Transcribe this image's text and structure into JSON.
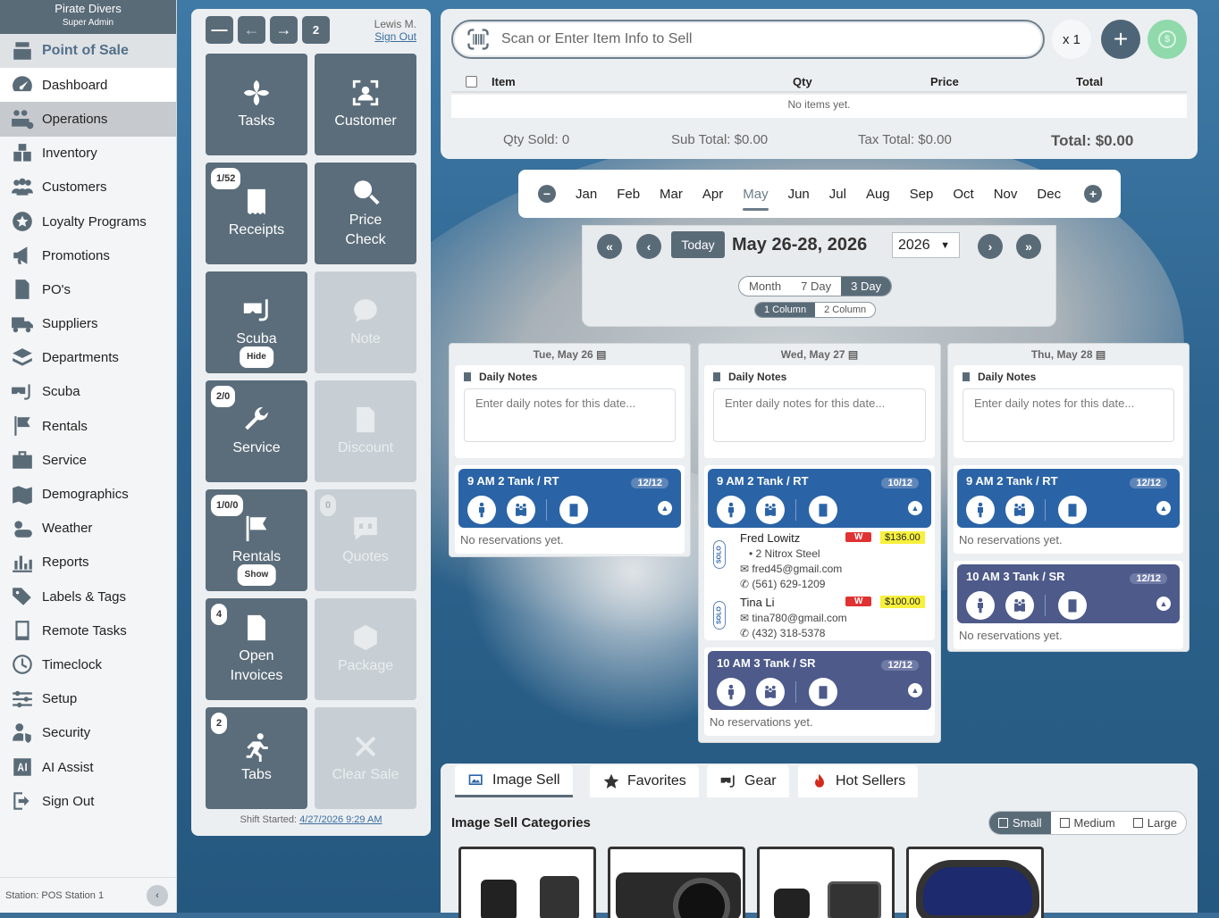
{
  "sidebar": {
    "company": "Pirate Divers",
    "role": "Super Admin",
    "items": [
      {
        "label": "Point of Sale",
        "icon": "register-icon"
      },
      {
        "label": "Dashboard",
        "icon": "speedometer-icon"
      },
      {
        "label": "Operations",
        "icon": "operations-icon"
      },
      {
        "label": "Inventory",
        "icon": "boxes-icon"
      },
      {
        "label": "Customers",
        "icon": "people-icon"
      },
      {
        "label": "Loyalty Programs",
        "icon": "loyalty-icon"
      },
      {
        "label": "Promotions",
        "icon": "megaphone-icon"
      },
      {
        "label": "PO's",
        "icon": "purchase-order-icon"
      },
      {
        "label": "Suppliers",
        "icon": "truck-icon"
      },
      {
        "label": "Departments",
        "icon": "layers-icon"
      },
      {
        "label": "Scuba",
        "icon": "mask-icon"
      },
      {
        "label": "Rentals",
        "icon": "flag-icon"
      },
      {
        "label": "Service",
        "icon": "toolbox-icon"
      },
      {
        "label": "Demographics",
        "icon": "map-icon"
      },
      {
        "label": "Weather",
        "icon": "weather-icon"
      },
      {
        "label": "Reports",
        "icon": "bar-chart-icon"
      },
      {
        "label": "Labels & Tags",
        "icon": "tags-icon"
      },
      {
        "label": "Remote Tasks",
        "icon": "tablet-icon"
      },
      {
        "label": "Timeclock",
        "icon": "clock-icon"
      },
      {
        "label": "Setup",
        "icon": "sliders-icon"
      },
      {
        "label": "Security",
        "icon": "user-shield-icon"
      },
      {
        "label": "AI Assist",
        "icon": "ai-icon"
      },
      {
        "label": "Sign Out",
        "icon": "sign-out-icon"
      }
    ],
    "station": "Station: POS Station 1"
  },
  "tiles_panel": {
    "nav_count": "2",
    "user_name": "Lewis M.",
    "sign_out": "Sign Out",
    "tiles": {
      "tasks": {
        "label": "Tasks"
      },
      "customer": {
        "label": "Customer"
      },
      "receipts": {
        "label": "Receipts",
        "badge": "1/52"
      },
      "price_check": {
        "label": "Price Check"
      },
      "scuba": {
        "label": "Scuba",
        "pill": "Hide"
      },
      "note": {
        "label": "Note"
      },
      "service": {
        "label": "Service",
        "badge": "2/0"
      },
      "discount": {
        "label": "Discount"
      },
      "rentals": {
        "label": "Rentals",
        "badge": "1/0/0",
        "pill": "Show"
      },
      "quotes": {
        "label": "Quotes",
        "badge": "0"
      },
      "open_invoices": {
        "label": "Open Invoices",
        "badge": "4"
      },
      "package": {
        "label": "Package"
      },
      "tabs": {
        "label": "Tabs",
        "badge": "2"
      },
      "clear_sale": {
        "label": "Clear Sale"
      }
    },
    "shift_label": "Shift Started:",
    "shift_time": "4/27/2026 9:29 AM"
  },
  "cart": {
    "scan_placeholder": "Scan or Enter Item Info to Sell",
    "qty_multiplier": "x 1",
    "columns": [
      "Item",
      "Qty",
      "Price",
      "Total"
    ],
    "empty_text": "No items yet.",
    "qty_sold": "Qty Sold: 0",
    "sub_total": "Sub Total: $0.00",
    "tax_total": "Tax Total: $0.00",
    "total": "Total: $0.00"
  },
  "months": [
    "Jan",
    "Feb",
    "Mar",
    "Apr",
    "May",
    "Jun",
    "Jul",
    "Aug",
    "Sep",
    "Oct",
    "Nov",
    "Dec"
  ],
  "selected_month": "May",
  "date_nav": {
    "today": "Today",
    "range": "May 26-28, 2026",
    "year": "2026",
    "views": [
      "Month",
      "7 Day",
      "3 Day"
    ],
    "active_view": "3 Day",
    "columns": [
      "1 Column",
      "2 Column"
    ],
    "active_columns": "1 Column"
  },
  "days": [
    {
      "header": "Tue, May 26",
      "notes_label": "Daily Notes",
      "notes_placeholder": "Enter daily notes for this date...",
      "trips": [
        {
          "title": "9 AM 2 Tank / RT",
          "capacity": "12/12",
          "empty": "No reservations yet."
        }
      ]
    },
    {
      "header": "Wed, May 27",
      "notes_label": "Daily Notes",
      "notes_placeholder": "Enter daily notes for this date...",
      "trips": [
        {
          "title": "9 AM 2 Tank / RT",
          "capacity": "10/12",
          "reservations": [
            {
              "name": "Fred Lowitz",
              "tag": "SOLO",
              "flag": "W",
              "price": "$136.00",
              "item": "• 2 Nitrox Steel",
              "email": "fred45@gmail.com",
              "phone": "(561) 629-1209"
            },
            {
              "name": "Tina Li",
              "tag": "SOLO",
              "flag": "W",
              "price": "$100.00",
              "email": "tina780@gmail.com",
              "phone": "(432) 318-5378"
            }
          ]
        },
        {
          "title": "10 AM 3 Tank / SR",
          "capacity": "12/12",
          "empty": "No reservations yet."
        }
      ]
    },
    {
      "header": "Thu, May 28",
      "notes_label": "Daily Notes",
      "notes_placeholder": "Enter daily notes for this date...",
      "trips": [
        {
          "title": "9 AM 2 Tank / RT",
          "capacity": "12/12",
          "empty": "No reservations yet."
        },
        {
          "title": "10 AM 3 Tank / SR",
          "capacity": "12/12",
          "empty": "No reservations yet."
        }
      ]
    }
  ],
  "image_sell": {
    "tabs": [
      "Image Sell",
      "Favorites",
      "Gear",
      "Hot Sellers"
    ],
    "title": "Image Sell Categories",
    "sizes": [
      "Small",
      "Medium",
      "Large"
    ],
    "active_size": "Small"
  },
  "colors": {
    "accent": "#5a6b78",
    "trip_rt": "#2b64a6",
    "trip_sr": "#4d5a8a",
    "warn": "#e03232",
    "price": "#f7f03c"
  }
}
